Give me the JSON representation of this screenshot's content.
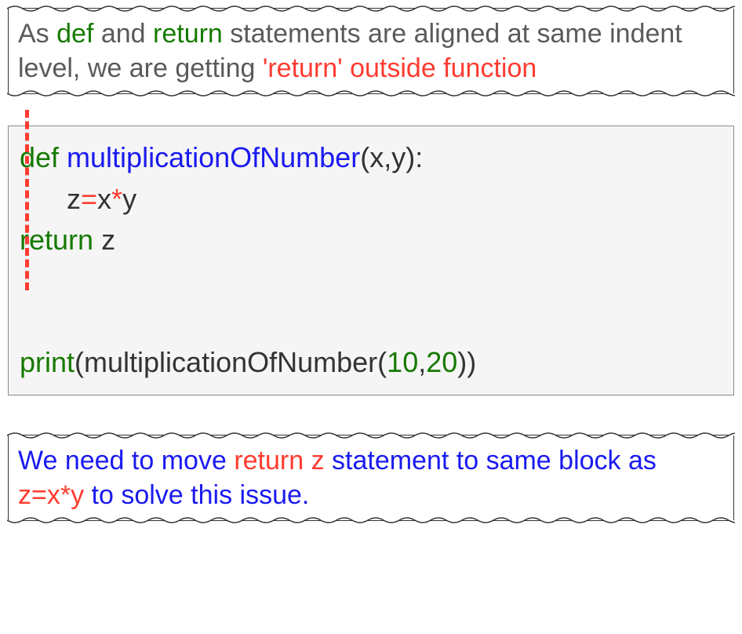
{
  "top_callout": {
    "t1": "As ",
    "t2": "def",
    "t3": " and ",
    "t4": "return",
    "t5": " statements are aligned at same indent level, we are getting ",
    "t6": "'return' outside function"
  },
  "code": {
    "l1_def": "def",
    "l1_name": " multiplicationOfNumber",
    "l1_paren_open": "(",
    "l1_args": "x,y",
    "l1_paren_close_colon": "):",
    "l2_indent": "      ",
    "l2_z": "z",
    "l2_eq": "=",
    "l2_x": "x",
    "l2_star": "*",
    "l2_y": "y",
    "l3_return": "return",
    "l3_space": " ",
    "l3_z": "z",
    "blank": "\n",
    "l5_print": "print",
    "l5_open": "(",
    "l5_call": "multiplicationOfNumber",
    "l5_open2": "(",
    "l5_n1": "10",
    "l5_comma": ",",
    "l5_n2": "20",
    "l5_close": "))"
  },
  "bottom_callout": {
    "t1": "We need to move ",
    "t2": "return z",
    "t3": " statement to same block as ",
    "t4": "z=x*y",
    "t5": " to solve this issue."
  }
}
